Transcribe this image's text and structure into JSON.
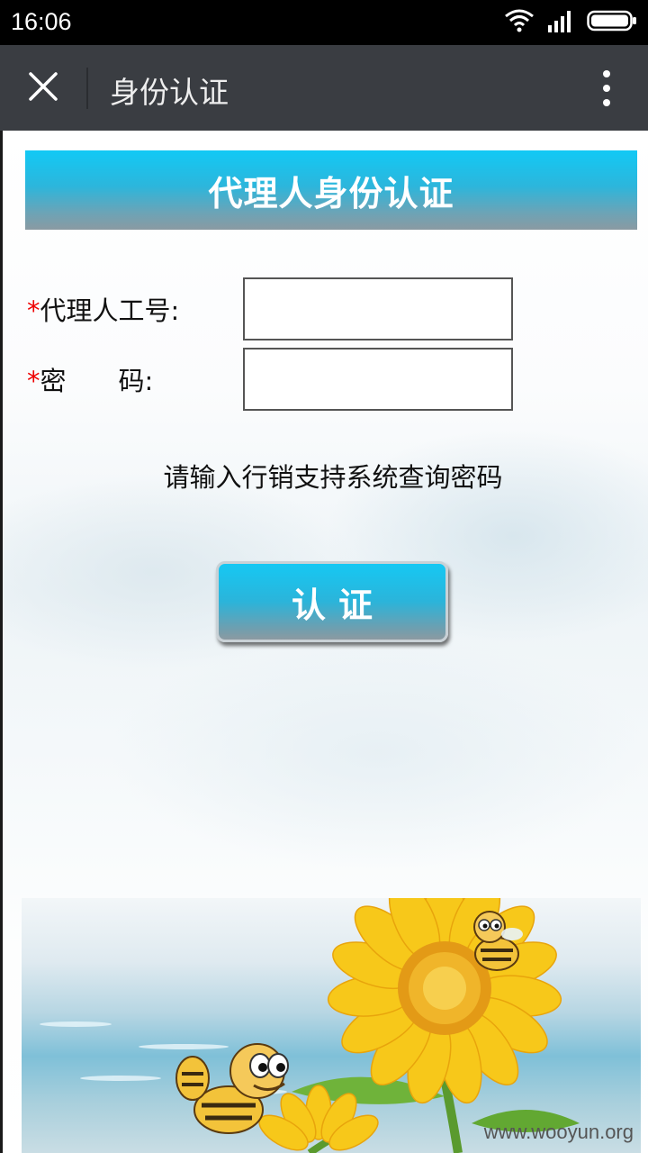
{
  "status_bar": {
    "time": "16:06",
    "icons": [
      "wifi-icon",
      "signal-icon",
      "battery-icon"
    ]
  },
  "title_bar": {
    "close_icon": "close-icon",
    "title": "身份认证",
    "more_icon": "more-vertical-icon"
  },
  "form": {
    "banner_title": "代理人身份认证",
    "required_mark": "*",
    "agent_id_label": "代理人工号:",
    "agent_id_value": "",
    "password_label": "密　　码:",
    "password_value": "",
    "hint": "请输入行销支持系统查询密码",
    "submit_label": "认证"
  },
  "banner": {
    "watermark": "www.wooyun.org"
  },
  "colors": {
    "accent_top": "#12c9f5",
    "accent_bottom": "#8a9aa2",
    "title_bar": "#3a3d42",
    "required": "#ee0000"
  }
}
